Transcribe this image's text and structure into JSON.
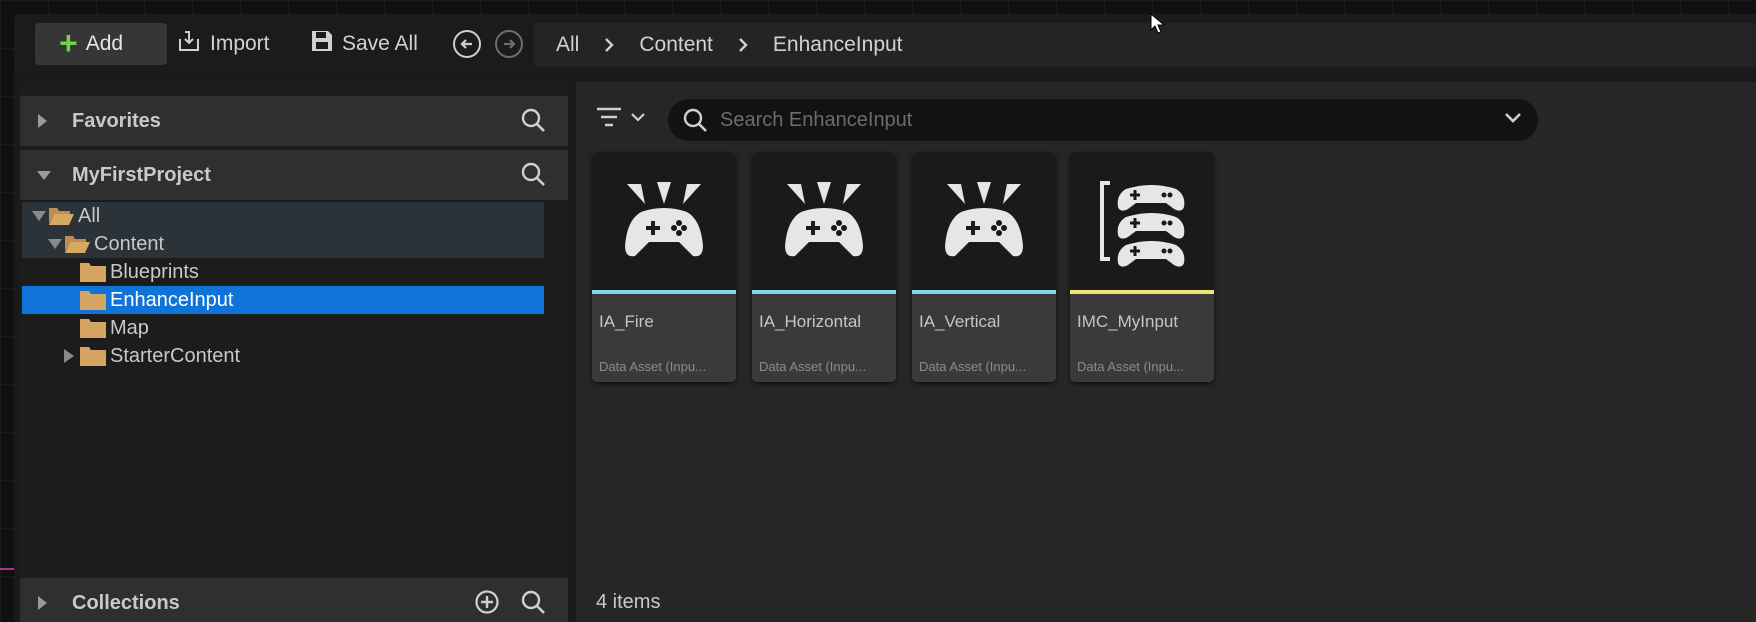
{
  "toolbar": {
    "add_label": "Add",
    "import_label": "Import",
    "save_all_label": "Save All",
    "breadcrumb": [
      "All",
      "Content",
      "EnhanceInput"
    ]
  },
  "sidebar": {
    "favorites_label": "Favorites",
    "project_label": "MyFirstProject",
    "collections_label": "Collections",
    "tree": [
      {
        "label": "All",
        "depth": 0,
        "expanded": true,
        "state": "highlight"
      },
      {
        "label": "Content",
        "depth": 1,
        "expanded": true,
        "state": "highlight"
      },
      {
        "label": "Blueprints",
        "depth": 2,
        "expanded": false,
        "state": "normal"
      },
      {
        "label": "EnhanceInput",
        "depth": 2,
        "expanded": false,
        "state": "selected"
      },
      {
        "label": "Map",
        "depth": 2,
        "expanded": false,
        "state": "normal"
      },
      {
        "label": "StarterContent",
        "depth": 2,
        "expanded": false,
        "state": "collapsed"
      }
    ]
  },
  "search": {
    "placeholder": "Search EnhanceInput",
    "value": ""
  },
  "assets": [
    {
      "name": "IA_Fire",
      "type": "Data Asset (Inpu...",
      "icon": "input-action-icon",
      "stripe_color": "#7fd8e6"
    },
    {
      "name": "IA_Horizontal",
      "type": "Data Asset (Inpu...",
      "icon": "input-action-icon",
      "stripe_color": "#7fd8e6"
    },
    {
      "name": "IA_Vertical",
      "type": "Data Asset (Inpu...",
      "icon": "input-action-icon",
      "stripe_color": "#7fd8e6"
    },
    {
      "name": "IMC_MyInput",
      "type": "Data Asset (Inpu...",
      "icon": "input-mapping-context-icon",
      "stripe_color": "#f2e27a"
    }
  ],
  "status": {
    "item_count": "4 items"
  },
  "colors": {
    "selection": "#0f73d8",
    "add_icon": "#6fd14e",
    "input_action_stripe": "#7fd8e6",
    "mapping_context_stripe": "#f2e27a"
  }
}
